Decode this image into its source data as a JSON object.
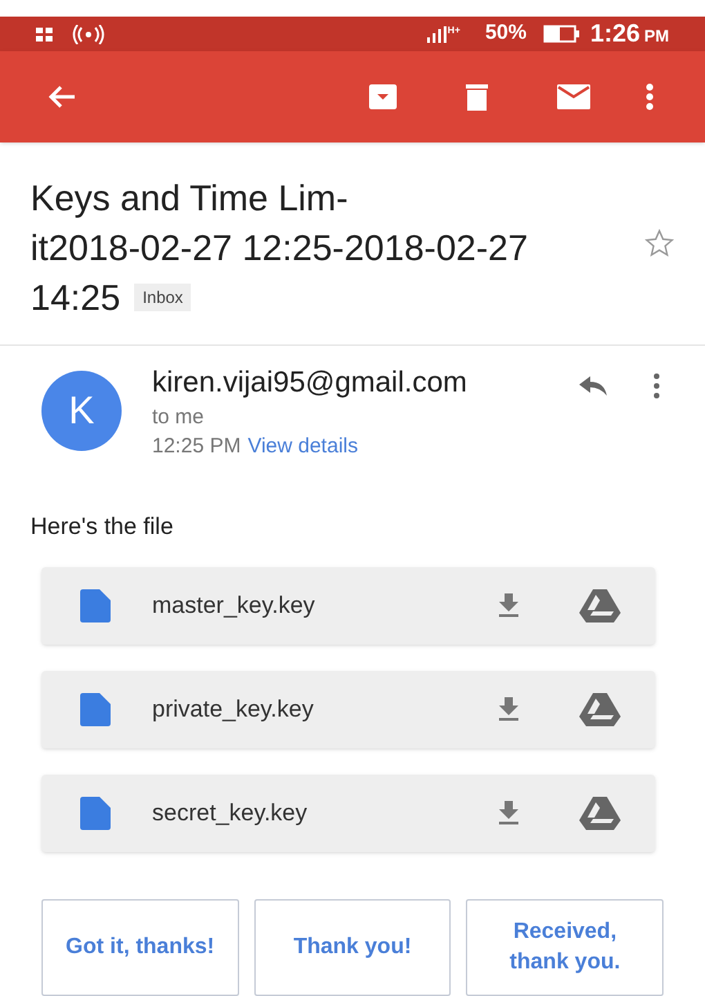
{
  "status_bar": {
    "signal_label": "H+",
    "battery": "50%",
    "time": "1:26",
    "ampm": "PM"
  },
  "subject": {
    "lines": [
      "Keys and Time Lim-",
      "it2018-02-27 12:25-2018-02-27",
      "14:25"
    ],
    "label": "Inbox",
    "starred": false
  },
  "message": {
    "avatar": "K",
    "sender": "kiren.vijai95@gmail.com",
    "recipient": "to me",
    "time": "12:25 PM",
    "details_link": "View details",
    "body": "Here's the file"
  },
  "attachments": [
    {
      "name": "master_key.key"
    },
    {
      "name": "private_key.key"
    },
    {
      "name": "secret_key.key"
    }
  ],
  "smart_replies": [
    "Got it, thanks!",
    "Thank you!",
    "Received, thank you."
  ]
}
